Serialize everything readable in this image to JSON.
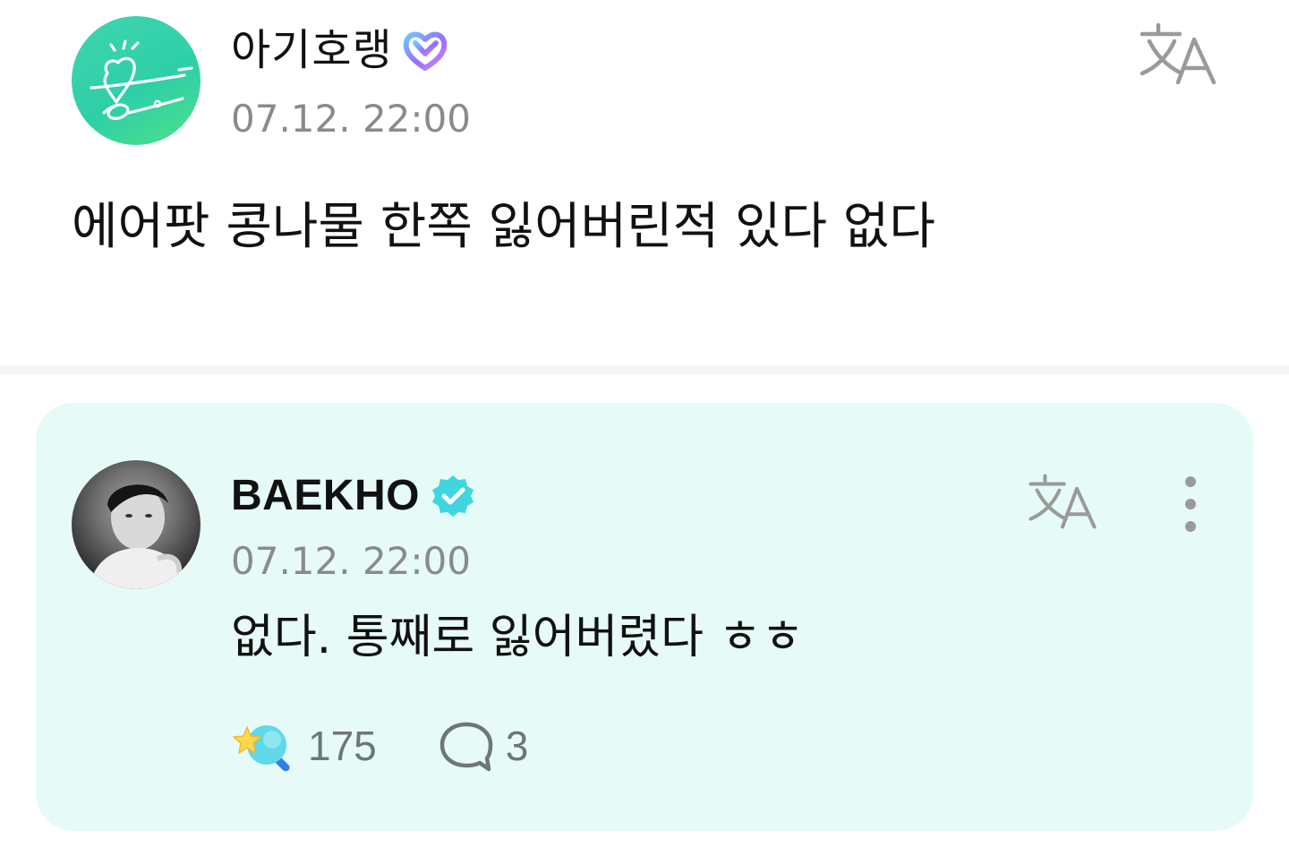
{
  "post": {
    "author_name": "아기호랭",
    "timestamp": "07.12. 22:00",
    "body": "에어팟 콩나물 한쪽 잃어버린적 있다 없다",
    "avatar_icon": "fan-avatar-heart-doodle",
    "badge_icon": "membership-heart-icon",
    "translate_icon": "translate-icon"
  },
  "reply": {
    "author_name": "BAEKHO",
    "timestamp": "07.12. 22:00",
    "body": "없다. 통째로 잃어버렸다 ㅎㅎ",
    "avatar_icon": "artist-profile-photo",
    "badge_icon": "verified-check-icon",
    "translate_icon": "translate-icon",
    "more_icon": "more-vertical-icon",
    "like_count": "175",
    "comment_count": "3"
  },
  "colors": {
    "reply_card_bg": "#e6fbf7",
    "verified_badge": "#3fd6e0",
    "timestamp_text": "#8a8a8a",
    "fan_avatar_bg": "#2ecfa8",
    "heart_badge_gradient": [
      "#6ec6ff",
      "#9b6cff",
      "#c78bff"
    ]
  }
}
